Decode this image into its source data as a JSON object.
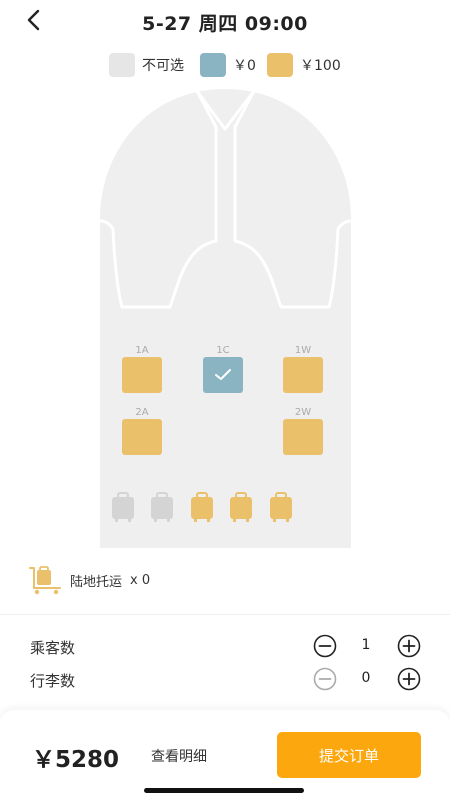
{
  "header": {
    "title": "5-27 周四 09:00",
    "back_icon": "chevron-left-icon"
  },
  "legend": [
    {
      "label": "不可选",
      "color": "#e6e6e6"
    },
    {
      "label": "￥0",
      "color": "#8ab4c2"
    },
    {
      "label": "￥100",
      "color": "#ebc06b"
    }
  ],
  "colors": {
    "unavailable": "#e6e6e6",
    "free": "#8ab4c2",
    "paid": "#ebc06b",
    "fuselage": "#efefef",
    "accent": "#fca70e"
  },
  "seats": [
    {
      "label": "1A",
      "state": "paid"
    },
    {
      "label": "1C",
      "state": "free",
      "selected": true
    },
    {
      "label": "1W",
      "state": "paid"
    },
    {
      "label": "2A",
      "state": "paid"
    },
    {
      "label": "2W",
      "state": "paid"
    }
  ],
  "luggage_slots": [
    "unavailable",
    "unavailable",
    "paid",
    "paid",
    "paid"
  ],
  "ground": {
    "label": "陆地托运",
    "count": "x 0"
  },
  "passengers": {
    "label": "乘客数",
    "value": "1"
  },
  "baggage": {
    "label": "行李数",
    "value": "0"
  },
  "footer": {
    "price": "￥5280",
    "detail": "查看明细",
    "submit": "提交订单"
  }
}
